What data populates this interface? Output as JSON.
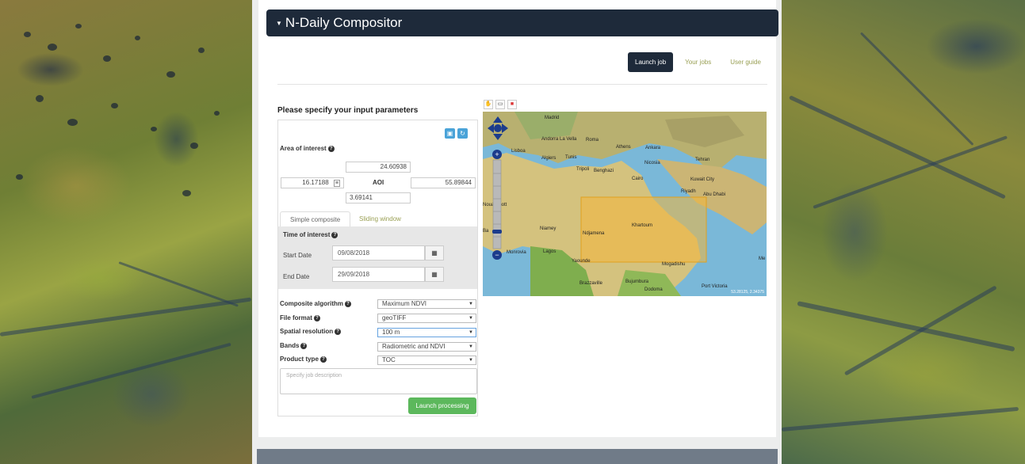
{
  "header": {
    "title": "N-Daily Compositor"
  },
  "nav": {
    "launch_job": "Launch job",
    "your_jobs": "Your jobs",
    "user_guide": "User guide"
  },
  "form": {
    "title": "Please specify your input parameters",
    "aoi": {
      "label": "Area of interest",
      "north": "24.60938",
      "west": "16.17188",
      "center_label": "AOI",
      "east": "55.89844",
      "south": "3.69141"
    },
    "tabs": {
      "simple": "Simple composite",
      "sliding": "Sliding window"
    },
    "time": {
      "label": "Time of interest",
      "start_label": "Start Date",
      "start_value": "09/08/2018",
      "end_label": "End Date",
      "end_value": "29/09/2018"
    },
    "fields": {
      "composite_label": "Composite algorithm",
      "composite_value": "Maximum NDVI",
      "format_label": "File format",
      "format_value": "geoTIFF",
      "resolution_label": "Spatial resolution",
      "resolution_value": "100 m",
      "bands_label": "Bands",
      "bands_value": "Radiometric and NDVI",
      "product_label": "Product type",
      "product_value": "TOC"
    },
    "description_placeholder": "Specify job description",
    "launch_label": "Launch processing"
  },
  "map": {
    "places": {
      "madrid": "Madrid",
      "andorra": "Andorra La Vella",
      "roma": "Roma",
      "lisboa": "Lisboa",
      "algiers": "Algiers",
      "tunis": "Tunis",
      "athens": "Athens",
      "ankara": "Ankara",
      "tripoli": "Tripoli",
      "benghazi": "Benghazi",
      "nicosia": "Nicosia",
      "cairo": "Cairo",
      "tehran": "Tehran",
      "kuwait": "Kuwait City",
      "riyadh": "Riyadh",
      "abudhabi": "Abu Dhabi",
      "nouakchott": "Nouakchott",
      "niamey": "Niamey",
      "ndjamena": "Ndjamena",
      "khartoum": "Khartoum",
      "monrovia": "Monrovia",
      "lagos": "Lagos",
      "yaounde": "Yaounde",
      "mogadishu": "Mogadishu",
      "brazzaville": "Brazzaville",
      "bujumbura": "Bujumbura",
      "dodoma": "Dodoma",
      "portvictoria": "Port Victoria",
      "ba": "Ba",
      "me": "Me"
    },
    "attribution": "53.28125, 2.34375"
  },
  "icons": {
    "caret": "caret-down-icon",
    "save": "save-icon",
    "reload": "reload-icon",
    "help": "question-circle-icon",
    "calendar": "calendar-icon",
    "select": "chevron-down-icon"
  },
  "colors": {
    "brand": "#1e2a3a",
    "accent": "#9aa055",
    "success": "#5cb85c",
    "info": "#4aa3d8",
    "aoi": "#f4b63a"
  }
}
